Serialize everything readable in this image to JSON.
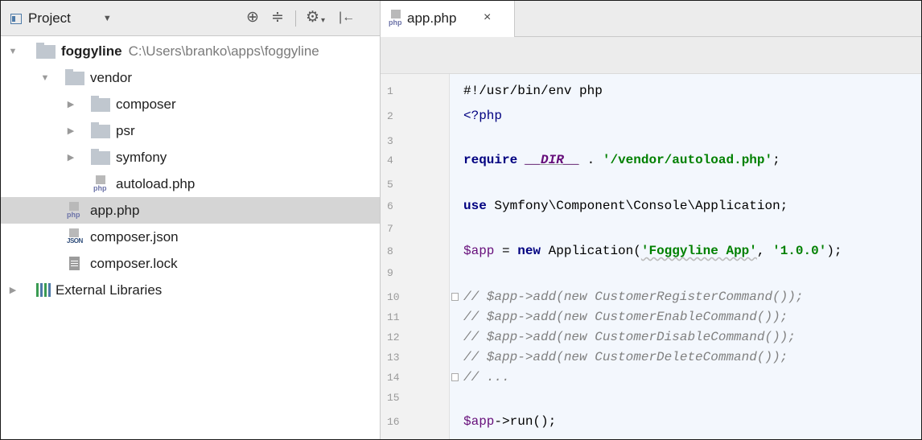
{
  "project_panel": {
    "title": "Project",
    "tree": [
      {
        "label": "foggyline",
        "path": "C:\\Users\\branko\\apps\\foggyline"
      },
      {
        "label": "vendor"
      },
      {
        "label": "composer"
      },
      {
        "label": "psr"
      },
      {
        "label": "symfony"
      },
      {
        "label": "autoload.php"
      },
      {
        "label": "app.php"
      },
      {
        "label": "composer.json"
      },
      {
        "label": "composer.lock"
      },
      {
        "label": "External Libraries"
      }
    ],
    "icon_tags": {
      "php": "php",
      "json": "JSON"
    }
  },
  "editor": {
    "tab_label": "app.php",
    "tab_close": "×",
    "line_numbers": [
      "1",
      "2",
      "3",
      "4",
      "5",
      "6",
      "7",
      "8",
      "9",
      "10",
      "11",
      "12",
      "13",
      "14",
      "15",
      "16"
    ],
    "code": {
      "l1": "#!/usr/bin/env php",
      "l2": "<?php",
      "l4_kw": "require",
      "l4_const": "__DIR__",
      "l4_dot": " . ",
      "l4_str": "'/vendor/autoload.php'",
      "l4_end": ";",
      "l6_kw": "use",
      "l6_rest": " Symfony\\Component\\Console\\Application;",
      "l8_var": "$app",
      "l8_eq": " = ",
      "l8_kw": "new",
      "l8_cls": " Application(",
      "l8_str1": "'Foggyline App'",
      "l8_comma": ", ",
      "l8_str2": "'1.0.0'",
      "l8_end": ");",
      "l10": "// $app->add(new CustomerRegisterCommand());",
      "l11": "// $app->add(new CustomerEnableCommand());",
      "l12": "// $app->add(new CustomerDisableCommand());",
      "l13": "// $app->add(new CustomerDeleteCommand());",
      "l14": "// ...",
      "l16_var": "$app",
      "l16_rest": "->run();"
    }
  },
  "colors": {
    "keyword": "#000080",
    "string": "#008000",
    "comment": "#808080",
    "selection": "#d5d5d5"
  }
}
